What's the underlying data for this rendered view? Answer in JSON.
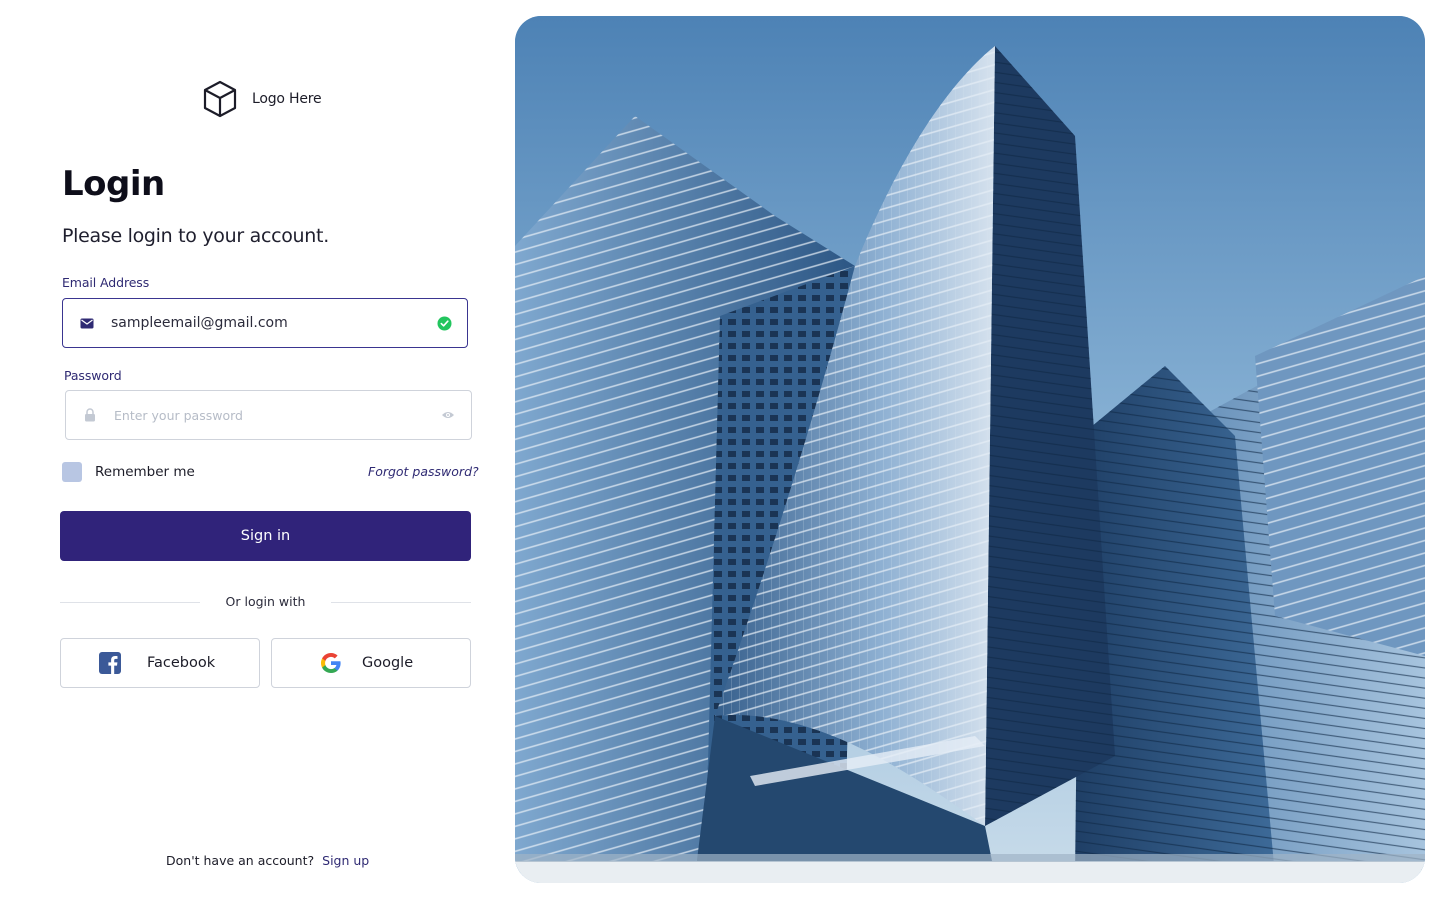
{
  "brand": {
    "logo_text": "Logo Here"
  },
  "login": {
    "title": "Login",
    "subtitle": "Please login to your account."
  },
  "email": {
    "label": "Email Address",
    "value": "sampleemail@gmail.com",
    "status": "valid"
  },
  "password": {
    "label": "Password",
    "placeholder": "Enter your password",
    "value": ""
  },
  "remember": {
    "label": "Remember me",
    "checked": false
  },
  "forgot": {
    "label": "Forgot password?"
  },
  "signin": {
    "label": "Sign in"
  },
  "divider": {
    "text": "Or login with"
  },
  "social": {
    "facebook": {
      "label": "Facebook",
      "icon": "facebook-icon"
    },
    "google": {
      "label": "Google",
      "icon": "google-icon"
    }
  },
  "footer": {
    "prompt": "Don't have an account?",
    "signup_label": "Sign up"
  },
  "colors": {
    "primary": "#30237a",
    "accent_text": "#2f2a73",
    "valid": "#22c55e",
    "checkbox": "#b8c6e3",
    "border": "#cfd3db"
  }
}
